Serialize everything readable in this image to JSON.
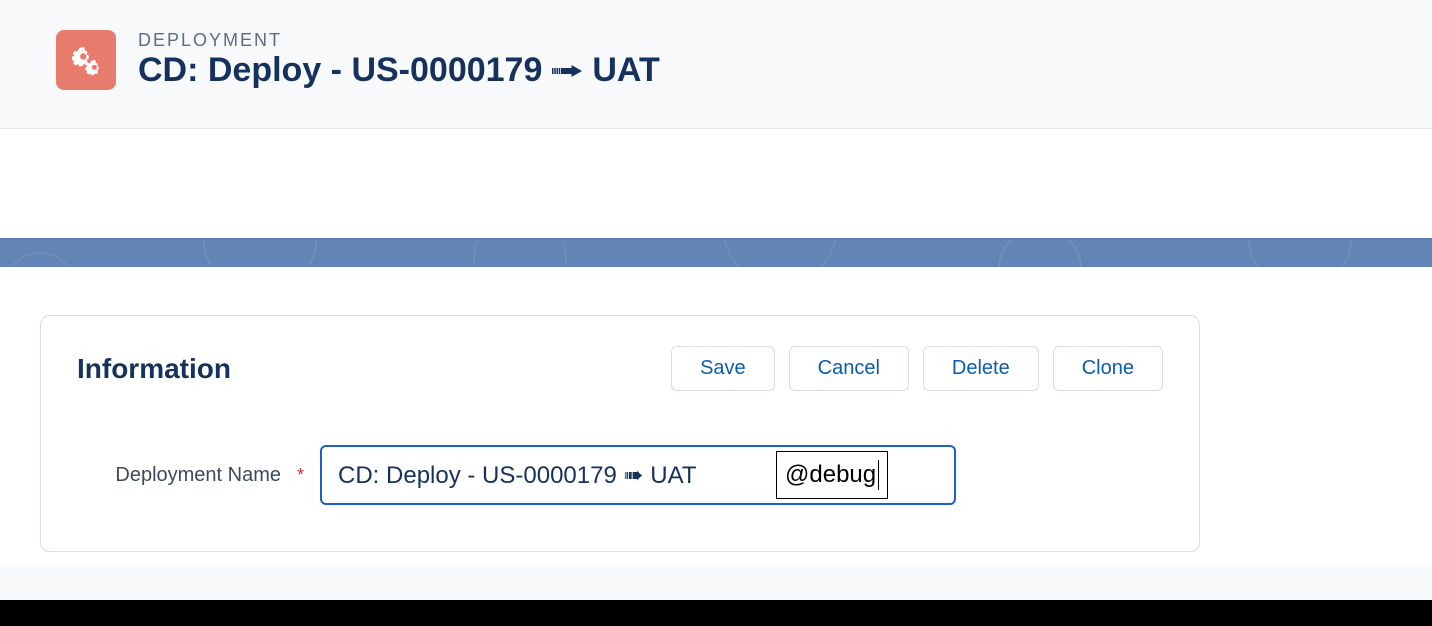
{
  "header": {
    "eyebrow": "DEPLOYMENT",
    "title_before_arrow": "CD: Deploy - US-0000179",
    "title_after_arrow": "UAT"
  },
  "section": {
    "title": "Information"
  },
  "buttons": {
    "save": "Save",
    "cancel": "Cancel",
    "delete": "Delete",
    "clone": "Clone"
  },
  "form": {
    "deployment_name_label": "Deployment Name",
    "deployment_name_value": "CD: Deploy - US-0000179 ➠ UAT",
    "ime_composition": "@debug"
  }
}
